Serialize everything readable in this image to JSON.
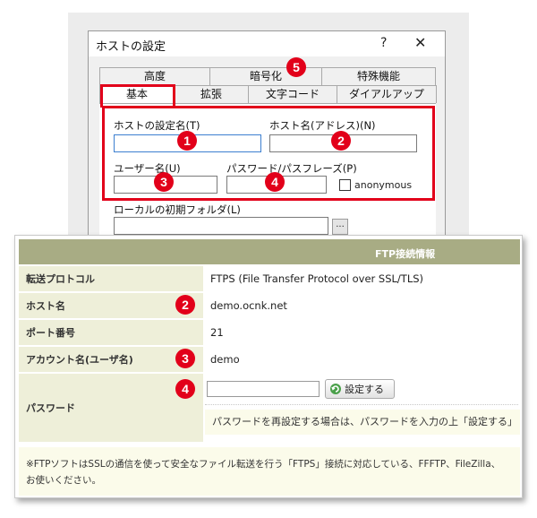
{
  "dialog": {
    "title": "ホストの設定",
    "help_glyph": "?",
    "close_glyph": "✕",
    "tabs_back": [
      "高度",
      "暗号化",
      "特殊機能"
    ],
    "tabs_front": [
      "基本",
      "拡張",
      "文字コード",
      "ダイアルアップ"
    ],
    "labels": {
      "host_setting_name": "ホストの設定名(T)",
      "host_name": "ホスト名(アドレス)(N)",
      "user_name": "ユーザー名(U)",
      "password": "パスワード/パスフレーズ(P)",
      "anonymous": "anonymous",
      "local_folder": "ローカルの初期フォルダ(L)"
    },
    "browse_label": "...",
    "badges": [
      "1",
      "2",
      "3",
      "4",
      "5"
    ]
  },
  "ftp_info": {
    "header": "FTP接続情報",
    "rows": {
      "protocol": {
        "label": "転送プロトコル",
        "value": "FTPS (File Transfer Protocol over SSL/TLS)"
      },
      "host": {
        "label": "ホスト名",
        "value": "demo.ocnk.net"
      },
      "port": {
        "label": "ポート番号",
        "value": "21"
      },
      "account": {
        "label": "アカウント名(ユーザ名)",
        "value": "demo"
      },
      "password": {
        "label": "パスワード"
      }
    },
    "set_button": "設定する",
    "password_hint": "パスワードを再設定する場合は、パスワードを入力の上「設定する」",
    "note": "※FTPソフトはSSLの通信を使って安全なファイル転送を行う「FTPS」接続に対応している、FFFTP、FileZilla、",
    "note2": "お使いください。",
    "badges": [
      "2",
      "3",
      "4"
    ]
  },
  "colors": {
    "accent_red": "#e2001a",
    "table_header": "#a8ac84",
    "table_key_bg": "#eeefd9",
    "hint_bg": "#fbfbea"
  }
}
